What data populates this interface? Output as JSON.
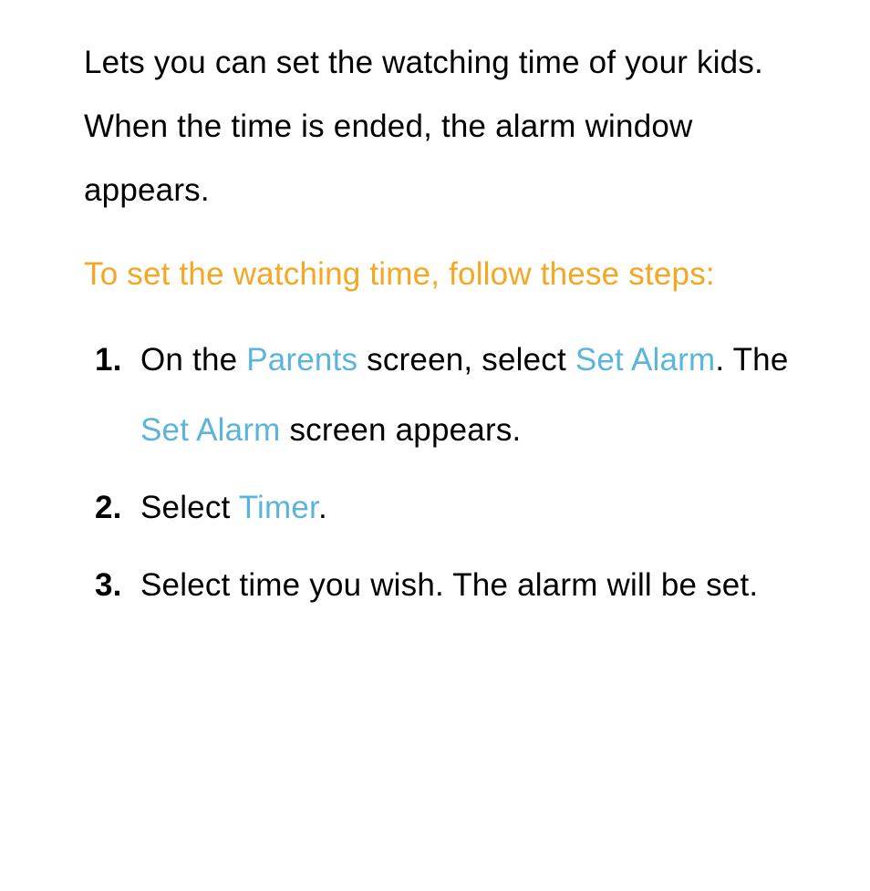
{
  "intro": "Lets you can set the watching time of your kids. When the time is ended, the alarm window appears.",
  "instruction": "To set the watching time, follow these steps:",
  "steps": {
    "s1": {
      "p1": "On the ",
      "hl1": "Parents",
      "p2": " screen, select ",
      "hl2": "Set Alarm",
      "p3": ". The ",
      "hl3": "Set Alarm",
      "p4": " screen appears."
    },
    "s2": {
      "p1": "Select ",
      "hl1": "Timer",
      "p2": "."
    },
    "s3": {
      "p1": "Select time you wish. The alarm will be set."
    }
  }
}
